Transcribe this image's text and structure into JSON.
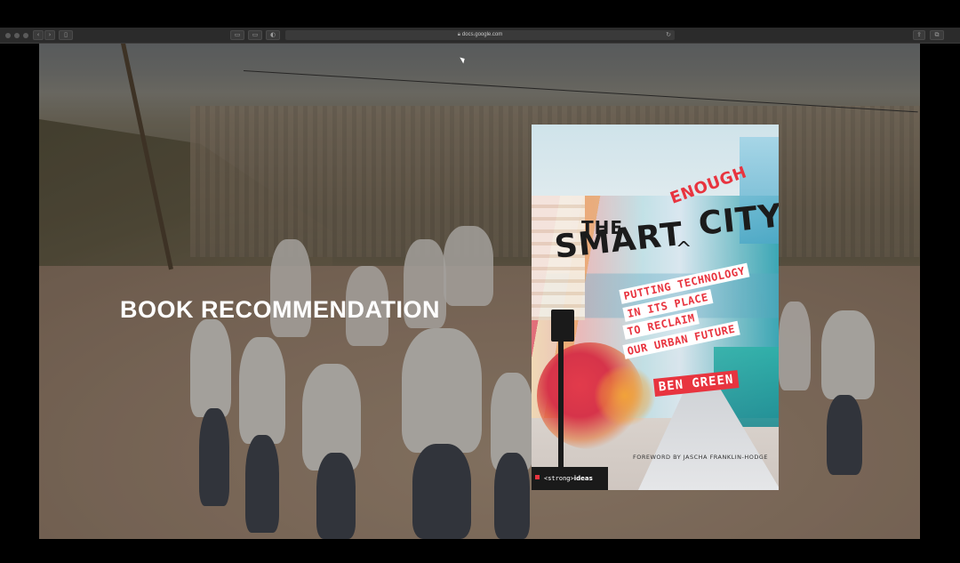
{
  "browser": {
    "url": "docs.google.com",
    "lock_icon": "lock-icon",
    "back_icon": "chevron-left-icon",
    "forward_icon": "chevron-right-icon",
    "sidebar_icon": "sidebar-icon",
    "reload_icon": "reload-icon",
    "share_icon": "share-icon",
    "tabs_icon": "tabs-icon"
  },
  "slide": {
    "title": "BOOK RECOMMENDATION"
  },
  "book": {
    "the": "THE",
    "enough": "ENOUGH",
    "caret": "^",
    "smart": "SMART",
    "city": "CITY",
    "subtitle_lines": [
      "PUTTING TECHNOLOGY",
      "IN ITS PLACE",
      "TO RECLAIM",
      "OUR URBAN FUTURE"
    ],
    "author": "BEN GREEN",
    "foreword": "FOREWORD BY JASCHA FRANKLIN-HODGE",
    "imprint_tag": "<strong>",
    "imprint_word": "ideas",
    "accent_color": "#e8343f"
  }
}
